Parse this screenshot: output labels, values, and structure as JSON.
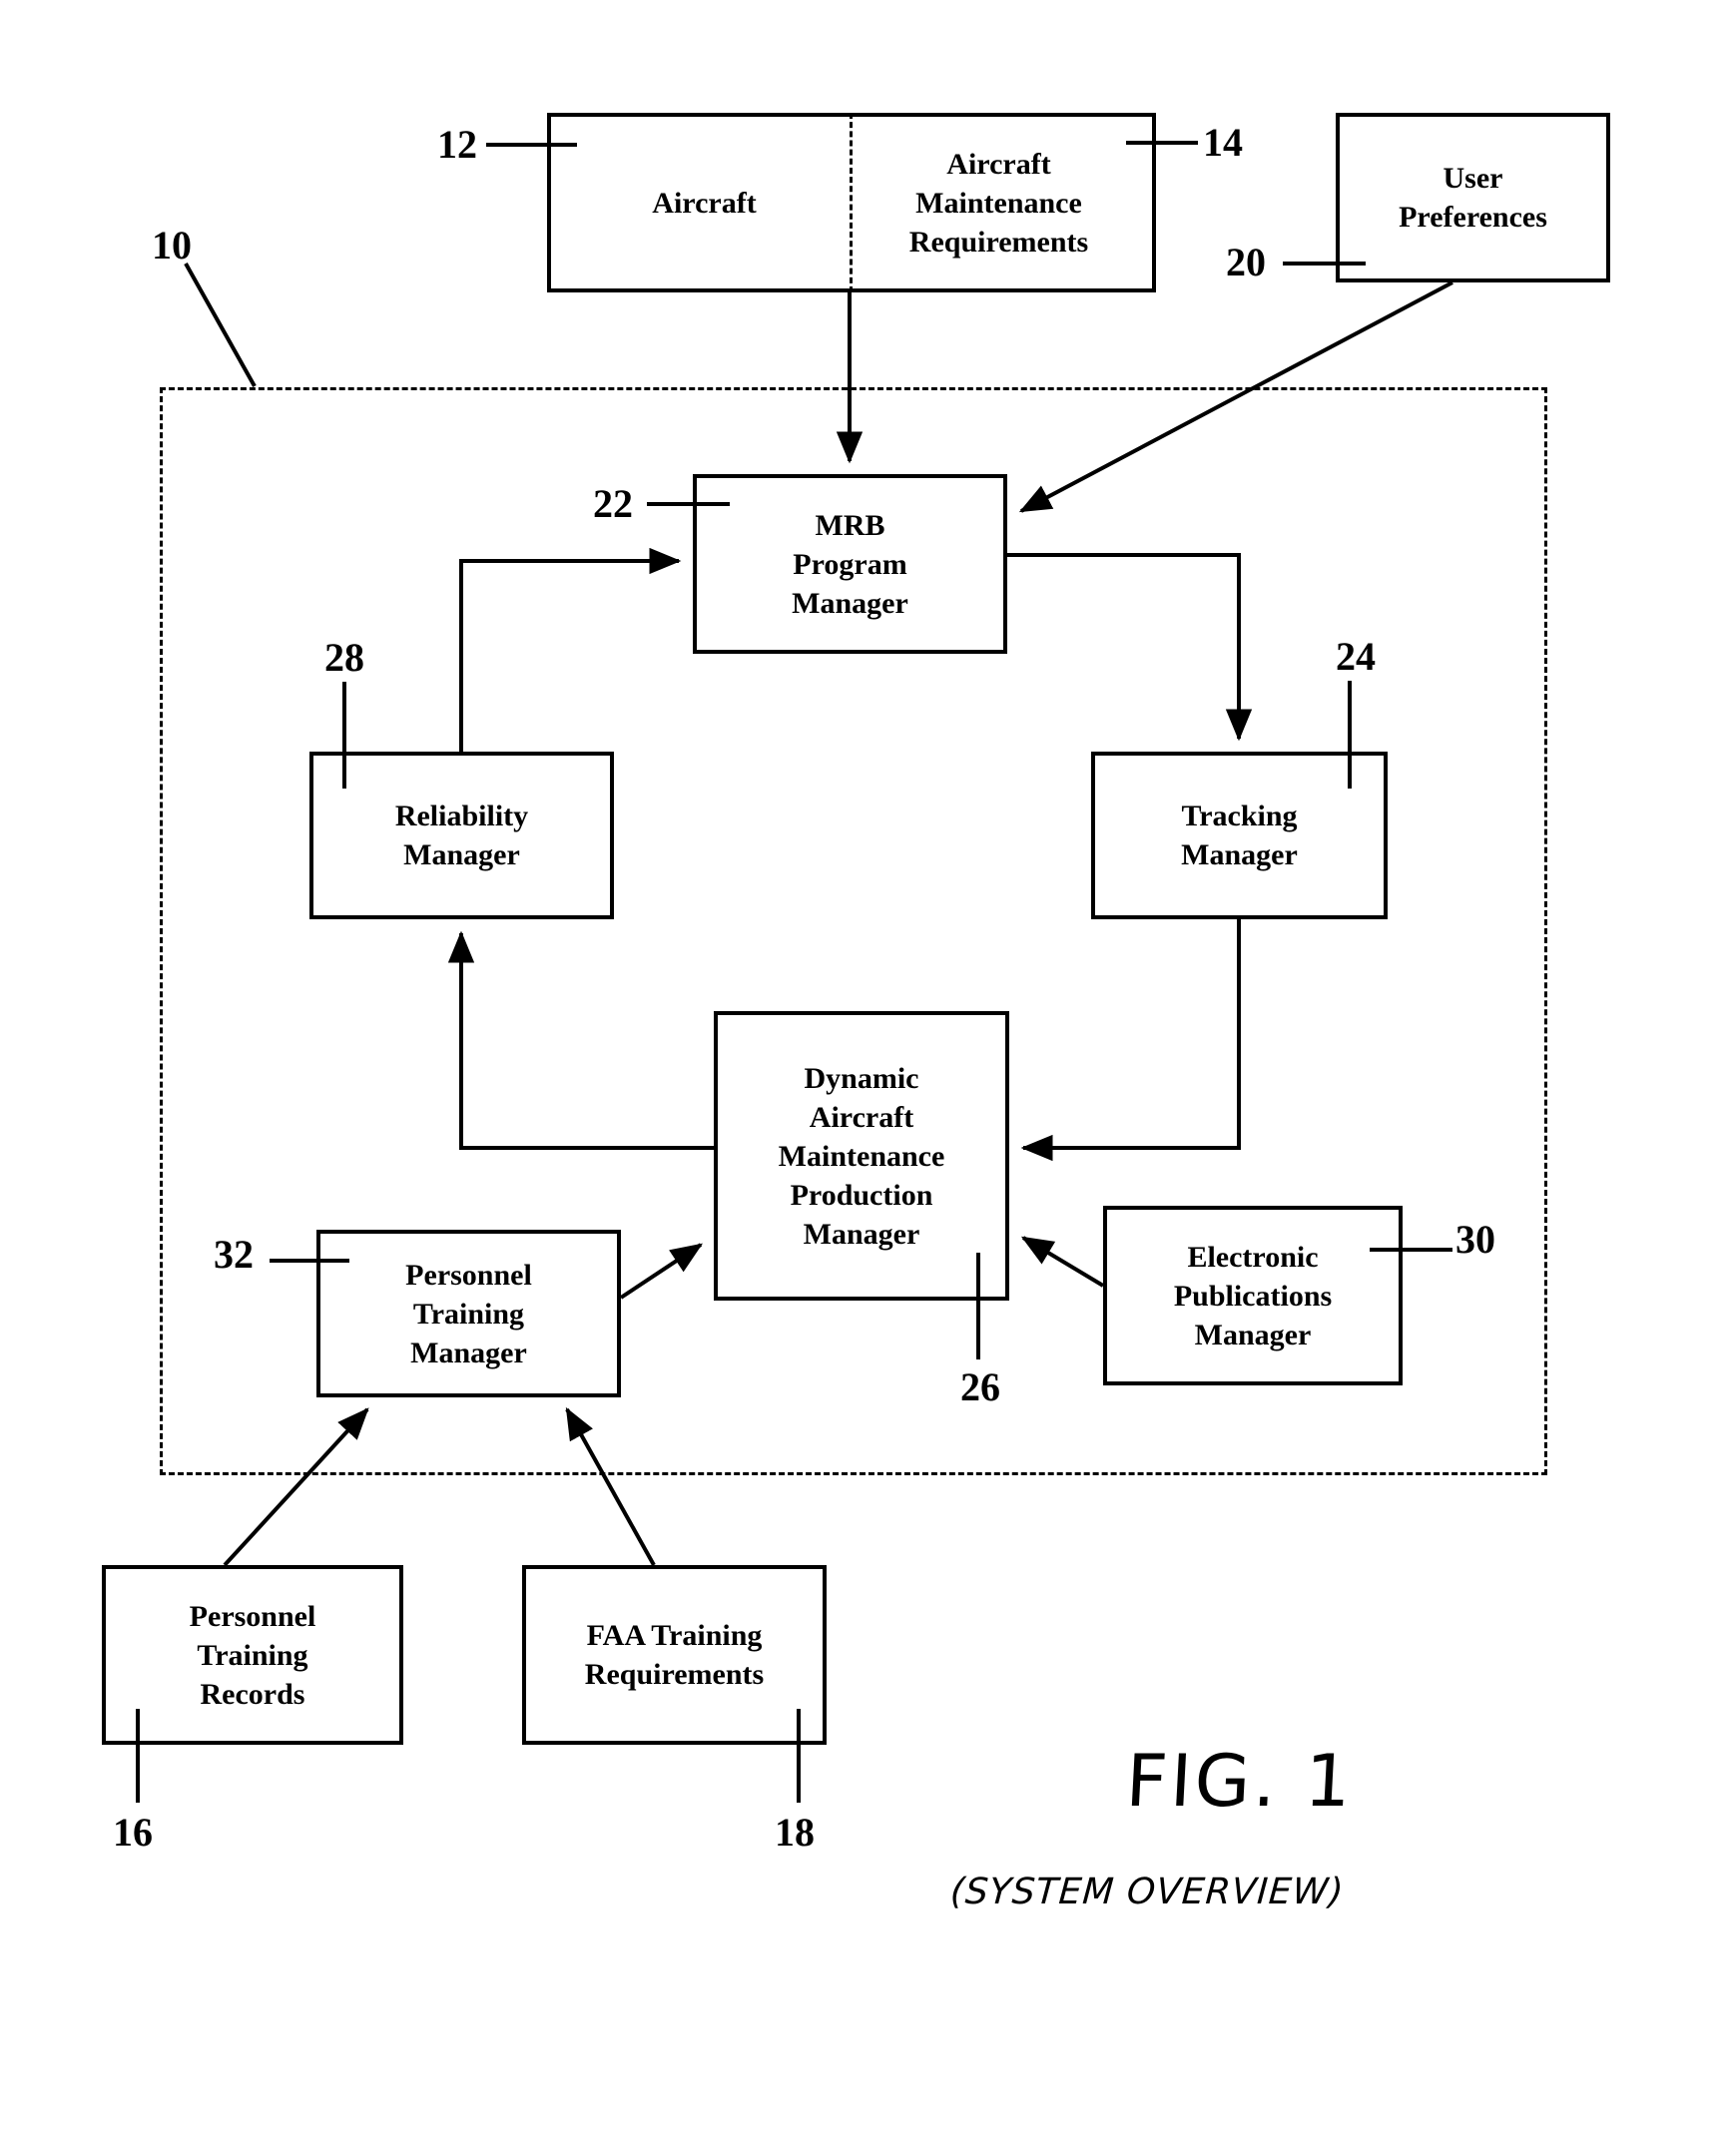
{
  "figure": {
    "number": "FIG. 1",
    "subtitle": "(SYSTEM OVERVIEW)"
  },
  "system_boundary": {
    "ref": "10",
    "style": "dashed"
  },
  "boxes": [
    {
      "id": "aircraft",
      "label": "Aircraft",
      "ref": "12"
    },
    {
      "id": "amr",
      "label": "Aircraft\nMaintenance\nRequirements",
      "ref": "14"
    },
    {
      "id": "user_preferences",
      "label": "User\nPreferences",
      "ref": "20"
    },
    {
      "id": "mrb_program_manager",
      "label": "MRB\nProgram\nManager",
      "ref": "22"
    },
    {
      "id": "reliability_manager",
      "label": "Reliability\nManager",
      "ref": "28"
    },
    {
      "id": "tracking_manager",
      "label": "Tracking\nManager",
      "ref": "24"
    },
    {
      "id": "damp_manager",
      "label": "Dynamic\nAircraft\nMaintenance\nProduction\nManager",
      "ref": "26"
    },
    {
      "id": "personnel_training_manager",
      "label": "Personnel\nTraining\nManager",
      "ref": "32"
    },
    {
      "id": "electronic_publications_manager",
      "label": "Electronic\nPublications\nManager",
      "ref": "30"
    },
    {
      "id": "personnel_training_records",
      "label": "Personnel\nTraining\nRecords",
      "ref": "16"
    },
    {
      "id": "faa_training_requirements",
      "label": "FAA Training\nRequirements",
      "ref": "18"
    }
  ],
  "refs": {
    "r10": "10",
    "r12": "12",
    "r14": "14",
    "r16": "16",
    "r18": "18",
    "r20": "20",
    "r22": "22",
    "r24": "24",
    "r26": "26",
    "r28": "28",
    "r30": "30",
    "r32": "32"
  },
  "connections": [
    {
      "from": "aircraft_maintenance_requirements",
      "to": "mrb_program_manager",
      "type": "arrow"
    },
    {
      "from": "user_preferences",
      "to": "mrb_program_manager",
      "type": "arrow"
    },
    {
      "from": "mrb_program_manager",
      "to": "tracking_manager",
      "type": "arrow"
    },
    {
      "from": "tracking_manager",
      "to": "damp_manager",
      "type": "arrow"
    },
    {
      "from": "damp_manager",
      "to": "reliability_manager",
      "type": "arrow"
    },
    {
      "from": "reliability_manager",
      "to": "mrb_program_manager",
      "type": "arrow"
    },
    {
      "from": "personnel_training_manager",
      "to": "damp_manager",
      "type": "arrow"
    },
    {
      "from": "electronic_publications_manager",
      "to": "damp_manager",
      "type": "arrow"
    },
    {
      "from": "personnel_training_records",
      "to": "personnel_training_manager",
      "type": "arrow"
    },
    {
      "from": "faa_training_requirements",
      "to": "personnel_training_manager",
      "type": "arrow"
    }
  ]
}
